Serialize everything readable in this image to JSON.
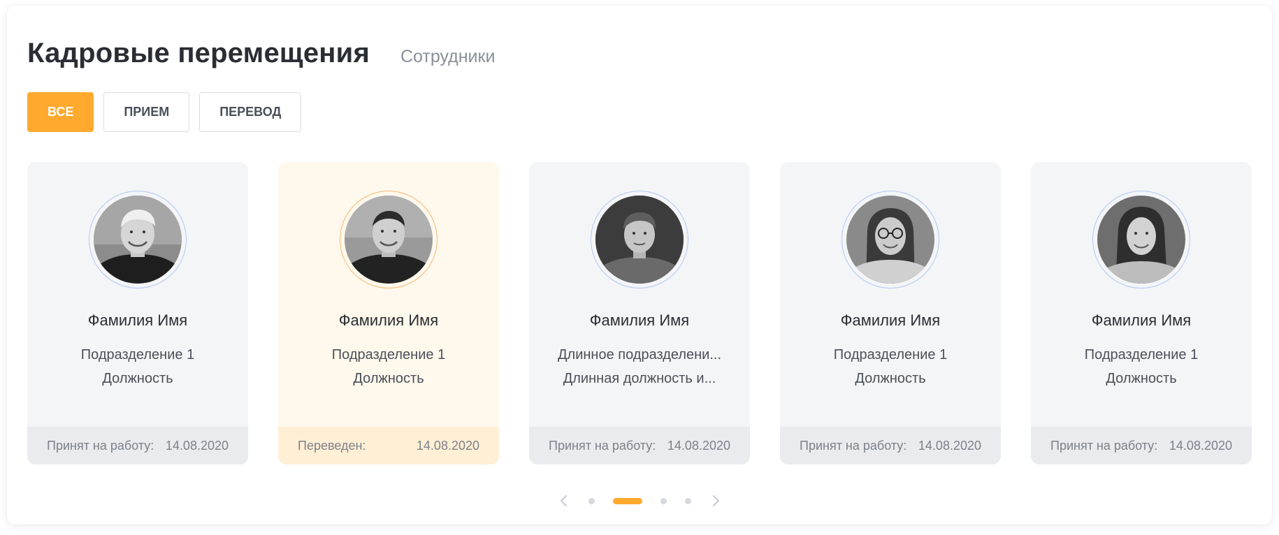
{
  "header": {
    "title": "Кадровые перемещения",
    "subtitle": "Сотрудники"
  },
  "filters": [
    {
      "label": "ВСЕ",
      "active": true
    },
    {
      "label": "ПРИЕМ",
      "active": false
    },
    {
      "label": "ПЕРЕВОД",
      "active": false
    }
  ],
  "cards": [
    {
      "name": "Фамилия Имя",
      "department": "Подразделение 1",
      "position": "Должность",
      "status_label": "Принят на работу:",
      "date": "14.08.2020",
      "highlighted": false,
      "photo": "avatar-photo-man-blond"
    },
    {
      "name": "Фамилия Имя",
      "department": "Подразделение 1",
      "position": "Должность",
      "status_label": "Переведен:",
      "date": "14.08.2020",
      "highlighted": true,
      "photo": "avatar-photo-man-dark"
    },
    {
      "name": "Фамилия Имя",
      "department": "Длинное подразделени...",
      "position": "Длинная должность и...",
      "status_label": "Принят на работу:",
      "date": "14.08.2020",
      "highlighted": false,
      "photo": "avatar-photo-boy"
    },
    {
      "name": "Фамилия Имя",
      "department": "Подразделение 1",
      "position": "Должность",
      "status_label": "Принят на работу:",
      "date": "14.08.2020",
      "highlighted": false,
      "photo": "avatar-photo-woman-glasses"
    },
    {
      "name": "Фамилия Имя",
      "department": "Подразделение 1",
      "position": "Должность",
      "status_label": "Принят на работу:",
      "date": "14.08.2020",
      "highlighted": false,
      "photo": "avatar-photo-woman"
    }
  ],
  "pager": {
    "prev_icon": "chevron-left-icon",
    "next_icon": "chevron-right-icon",
    "page_count": 4,
    "active_page": 2
  },
  "colors": {
    "accent": "#ffa92e",
    "card_bg": "#f4f5f7",
    "card_highlight_bg": "#fff8ec",
    "footer_highlight_bg": "#ffefd5"
  }
}
